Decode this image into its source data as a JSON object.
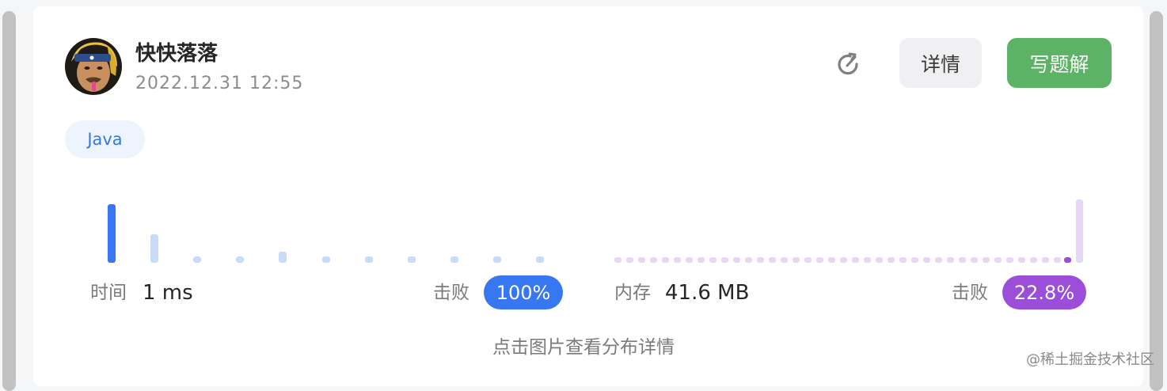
{
  "user": {
    "name": "快快落落",
    "timestamp": "2022.12.31 12:55"
  },
  "actions": {
    "details_label": "详情",
    "write_solution_label": "写题解"
  },
  "language_tag": "Java",
  "runtime": {
    "label": "时间",
    "value": "1 ms",
    "beat_label": "击败",
    "beat_value": "100%"
  },
  "memory": {
    "label": "内存",
    "value": "41.6 MB",
    "beat_label": "击败",
    "beat_value": "22.8%"
  },
  "hint": "点击图片查看分布详情",
  "watermark": "@稀土掘金技术社区",
  "colors": {
    "primary_blue": "#3877f2",
    "light_blue": "#c8dcf8",
    "purple": "#9b4fd9",
    "light_purple": "#e8d6f5",
    "green": "#5cb365"
  },
  "icons": {
    "refresh": "refresh-icon",
    "avatar": "user-avatar"
  }
}
